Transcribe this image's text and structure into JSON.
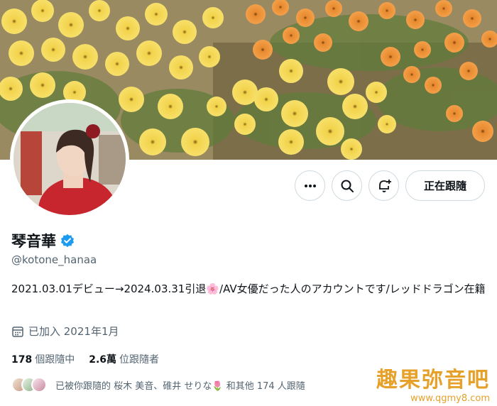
{
  "profile": {
    "display_name": "琴音華",
    "handle": "@kotone_hanaa",
    "bio": "2021.03.01デビュー→2024.03.31引退🌸/AV女優だった人のアカウントです/レッドドラゴン在籍",
    "joined": "已加入 2021年1月",
    "verified_color": "#1d9bf0"
  },
  "actions": {
    "more_icon": "more-icon",
    "search_icon": "search-icon",
    "notify_icon": "bell-plus-icon",
    "follow_label": "正在跟隨"
  },
  "stats": {
    "following_count": "178",
    "following_label": "個跟隨中",
    "followers_count": "2.6萬",
    "followers_label": "位跟隨者"
  },
  "followed_by": {
    "text": "已被你跟隨的 桜木 美音、碓井 せりな🌷 和其他 174 人跟隨"
  },
  "watermark": {
    "title": "趣果弥音吧",
    "url": "www.qgmy8.com"
  }
}
